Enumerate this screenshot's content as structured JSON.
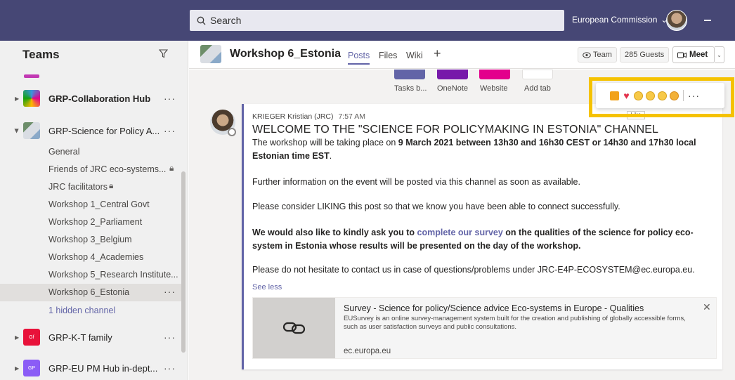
{
  "topbar": {
    "search_placeholder": "Search",
    "org_name": "European Commission",
    "org_caret": "⌄"
  },
  "sidebar": {
    "title": "Teams",
    "teams": [
      {
        "name": "GRP-Collaboration Hub",
        "color": "#3a96dd"
      },
      {
        "name": "GRP-Science for Policy A...",
        "color": "#6d8e6a"
      },
      {
        "name": "GRP-K-T family",
        "color": "#e8123a",
        "initials": "Gf"
      },
      {
        "name": "GRP-EU PM Hub in-dept...",
        "color": "#8b5cf6",
        "initials": "GP"
      }
    ],
    "channels": [
      "General",
      "Friends of JRC eco-systems...",
      "JRC facilitators",
      "Workshop 1_Central Govt",
      "Workshop 2_Parliament",
      "Workshop 3_Belgium",
      "Workshop 4_Academies",
      "Workshop 5_Research Institute...",
      "Workshop 6_Estonia"
    ],
    "hidden_channels": "1 hidden channel",
    "more": "···"
  },
  "header": {
    "channel_title": "Workshop 6_Estonia",
    "tabs": [
      "Posts",
      "Files",
      "Wiki"
    ],
    "plus": "+",
    "team_button": "Team",
    "guests_button": "285 Guests",
    "meet_button": "Meet"
  },
  "tab_tiles": [
    {
      "label": "Tasks b...",
      "color": "#6264a7"
    },
    {
      "label": "OneNote",
      "color": "#7719aa"
    },
    {
      "label": "Website",
      "color": "#e3008c"
    },
    {
      "label": "Add tab",
      "color": "#ffffff"
    }
  ],
  "post": {
    "author": "KRIEGER Kristian (JRC)",
    "time": "7:57 AM",
    "headline": "WELCOME TO THE \"SCIENCE FOR POLICYMAKING IN ESTONIA\" CHANNEL",
    "p1_start": "The workshop will be taking place on ",
    "p1_bold": "9 March 2021 between 13h30 and 16h30 CEST or 14h30 and 17h30 local Estonian time EST",
    "p1_end": ".",
    "p2": "Further information on the event will be posted via this channel as soon as available.",
    "p3": "Please consider LIKING this post so that we know you have been able to connect successfully.",
    "p4_start": "We would also like to kindly ask you to ",
    "p4_link": "complete our survey",
    "p4_end": " on the qualities of the science for policy eco-system in Estonia whose results will be presented on the day of the workshop.",
    "p5": "Please do not hesitate to contact us in case of questions/problems under JRC-E4P-ECOSYSTEM@ec.europa.eu.",
    "see_less": "See less"
  },
  "card": {
    "title": "Survey - Science for policy/Science advice Eco-systems in Europe - Qualities",
    "description": "EUSurvey is an online survey-management system built for the creation and publishing of globally accessible forms, such as user satisfaction surveys and public consultations.",
    "domain": "ec.europa.eu",
    "close": "✕"
  },
  "reactions": {
    "items": [
      "like",
      "heart",
      "laugh",
      "surprised",
      "sad",
      "angry"
    ],
    "tooltip": "Like",
    "more": "···",
    "highlight_color": "#f5c200"
  }
}
